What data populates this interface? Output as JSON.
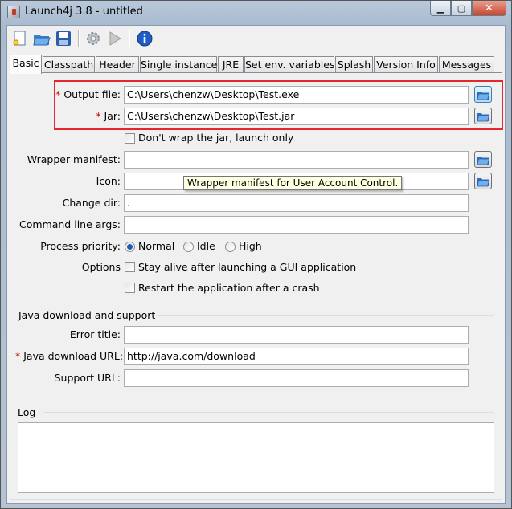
{
  "window": {
    "title": "Launch4j 3.8 - untitled",
    "controls": {
      "minimize": "▁",
      "maximize": "▢",
      "close": "✕"
    }
  },
  "toolbar": {
    "buttons": [
      {
        "icon": "new-config-icon"
      },
      {
        "icon": "open-folder-icon"
      },
      {
        "icon": "save-icon"
      },
      {
        "icon": "build-gear-icon"
      },
      {
        "icon": "run-play-icon"
      },
      {
        "icon": "about-info-icon"
      }
    ]
  },
  "tabs": [
    {
      "label": "Basic",
      "active": true
    },
    {
      "label": "Classpath"
    },
    {
      "label": "Header"
    },
    {
      "label": "Single instance"
    },
    {
      "label": "JRE"
    },
    {
      "label": "Set env. variables"
    },
    {
      "label": "Splash"
    },
    {
      "label": "Version Info"
    },
    {
      "label": "Messages"
    }
  ],
  "basic": {
    "output_file": {
      "label": "Output file:",
      "value": "C:\\Users\\chenzw\\Desktop\\Test.exe"
    },
    "jar": {
      "label": "Jar:",
      "value": "C:\\Users\\chenzw\\Desktop\\Test.jar"
    },
    "dont_wrap": "Don't wrap the jar, launch only",
    "wrapper_manifest": {
      "label": "Wrapper manifest:",
      "value": ""
    },
    "icon": {
      "label": "Icon:",
      "value": ""
    },
    "change_dir": {
      "label": "Change dir:",
      "value": "."
    },
    "cmd_args": {
      "label": "Command line args:",
      "value": ""
    },
    "priority": {
      "label": "Process priority:",
      "options": [
        "Normal",
        "Idle",
        "High"
      ],
      "selected": "Normal"
    },
    "options": {
      "label": "Options",
      "stay_alive": "Stay alive after launching a GUI application",
      "restart": "Restart the application after a crash"
    },
    "java_section": {
      "title": "Java download and support",
      "error_title": {
        "label": "Error title:",
        "value": ""
      },
      "download_url": {
        "label": "Java download URL:",
        "value": "http://java.com/download"
      },
      "support_url": {
        "label": "Support URL:",
        "value": ""
      }
    },
    "required_mark": "*"
  },
  "tooltip": "Wrapper manifest for User Account Control.",
  "log": {
    "title": "Log"
  },
  "colors": {
    "required": "#d00000",
    "highlight": "#e5262c",
    "radio_selected": "#1c5bb8"
  }
}
